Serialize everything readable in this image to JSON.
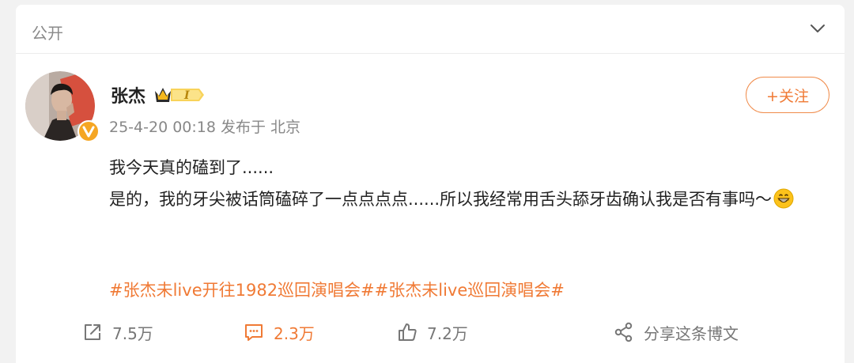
{
  "visibility": {
    "label": "公开",
    "toggle_icon": "chevron-down-icon"
  },
  "post": {
    "author": {
      "name": "张杰",
      "badge_icon": "crown-level-badge-icon",
      "badge_level": "I",
      "verified_icon": "verified-v-icon"
    },
    "meta": "25-4-20 00:18  发布于 北京",
    "follow_label": "+关注",
    "content": {
      "line1": "我今天真的磕到了......",
      "line2": "是的，我的牙尖被话筒磕碎了一点点点点......所以我经常用舌头舔牙齿确认我是否有事吗～",
      "emoji_icon": "grinning-face-icon"
    },
    "tags": [
      "#张杰未live开往1982巡回演唱会#",
      "#张杰未live巡回演唱会#"
    ]
  },
  "actions": {
    "repost": {
      "icon": "share-arrow-icon",
      "count": "7.5万"
    },
    "comment": {
      "icon": "comment-icon",
      "count": "2.3万"
    },
    "like": {
      "icon": "thumbs-up-icon",
      "count": "7.2万"
    },
    "share": {
      "icon": "share-nodes-icon",
      "label": "分享这条博文"
    }
  },
  "colors": {
    "accent": "#f07a35",
    "muted": "#888888",
    "text": "#222222",
    "background": "#f2f2f2",
    "badge_gold": "#f5b81c"
  }
}
